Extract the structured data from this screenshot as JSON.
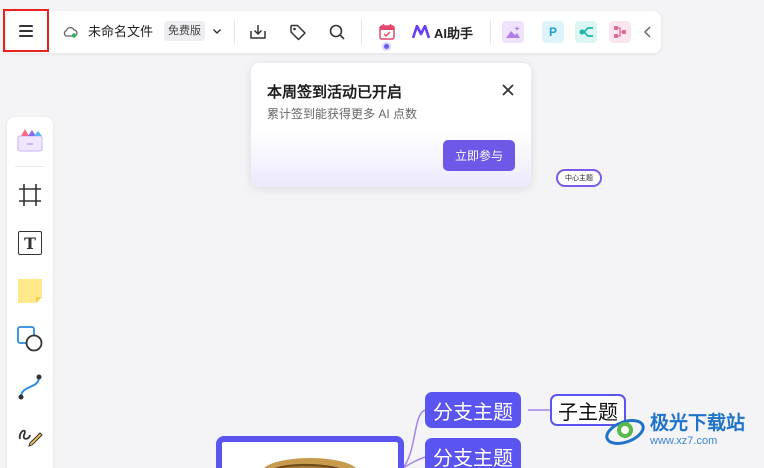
{
  "toolbar": {
    "file_name": "未命名文件",
    "plan_badge": "免费版",
    "ai_label": "AI助手",
    "icons": {
      "menu": "menu-icon",
      "cloud": "cloud-sync-icon",
      "dropdown": "chevron-down-icon",
      "export": "download-icon",
      "tag": "tag-icon",
      "search": "search-icon",
      "calendar": "calendar-checkin-icon",
      "ai": "ai-logo-icon",
      "image_tool": "image-app-icon",
      "p_tool": "p-app-icon",
      "mindmap_tool": "mindmap-app-icon",
      "org_tool": "org-chart-app-icon",
      "collapse": "chevron-left-icon"
    },
    "p_tile_label": "P"
  },
  "popup": {
    "title": "本周签到活动已开启",
    "description": "累计签到能获得更多 AI 点数",
    "button_label": "立即参与",
    "close_icon": "close-icon"
  },
  "canvas": {
    "center_node_label": "中心主题",
    "branches": [
      "分支主题",
      "分支主题"
    ],
    "sub_topic": "子主题"
  },
  "sidebar": {
    "items": [
      {
        "name": "template",
        "icon": "template-icon"
      },
      {
        "name": "frame",
        "icon": "frame-icon"
      },
      {
        "name": "text",
        "icon": "text-icon",
        "glyph": "T"
      },
      {
        "name": "sticky-note",
        "icon": "sticky-note-icon"
      },
      {
        "name": "shape",
        "icon": "shape-icon"
      },
      {
        "name": "connector",
        "icon": "connector-icon"
      },
      {
        "name": "pen",
        "icon": "pen-icon"
      }
    ]
  },
  "watermark": {
    "name": "极光下载站",
    "url": "www.xz7.com"
  },
  "colors": {
    "accent": "#5a55f0",
    "popup_button": "#6d58e8",
    "highlight_border": "#e8231f",
    "watermark": "#1f73c8"
  }
}
